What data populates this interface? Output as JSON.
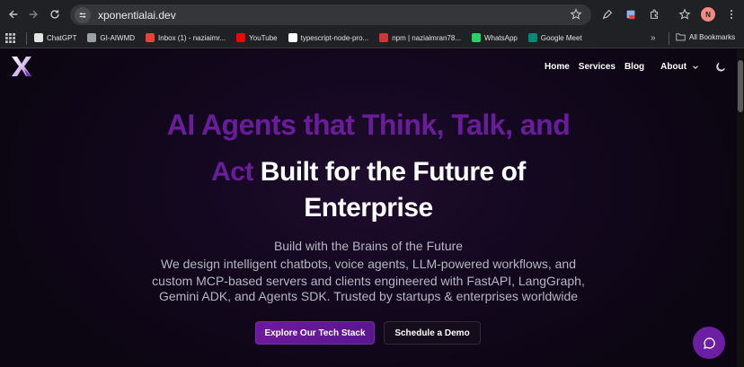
{
  "browser": {
    "url": "xponentialai.dev",
    "profile_initial": "N",
    "bookmarks": [
      {
        "label": "ChatGPT",
        "icon": "chatgpt-icon",
        "color": "#e3e3e3"
      },
      {
        "label": "GI-AIWMD",
        "icon": "github-style-icon",
        "color": "#9aa0a6"
      },
      {
        "label": "Inbox (1) - naziaimr...",
        "icon": "gmail-icon",
        "color": "#ea4335"
      },
      {
        "label": "YouTube",
        "icon": "youtube-icon",
        "color": "#ff0000"
      },
      {
        "label": "typescript-node-pro...",
        "icon": "github-icon",
        "color": "#ffffff"
      },
      {
        "label": "npm | naziaimran78...",
        "icon": "npm-icon",
        "color": "#cb3837"
      },
      {
        "label": "WhatsApp",
        "icon": "whatsapp-icon",
        "color": "#25d366"
      },
      {
        "label": "Google Meet",
        "icon": "google-meet-icon",
        "color": "#00897b"
      }
    ],
    "more_label": "»",
    "all_bookmarks_label": "All Bookmarks"
  },
  "site": {
    "nav": {
      "home": "Home",
      "services": "Services",
      "blog": "Blog",
      "about": "About"
    },
    "hero": {
      "line1": "AI Agents that Think, Talk, and",
      "line2_purple": "Act",
      "line2_white": " Built for the Future of",
      "line3": "Enterprise",
      "tagline": "Build with the Brains of the Future",
      "desc1": "We design intelligent chatbots, voice agents, LLM-powered workflows, and",
      "desc2": "custom MCP-based servers and clients engineered with FastAPI, LangGraph,",
      "desc3": "Gemini ADK, and Agents SDK. Trusted by startups & enterprises worldwide"
    },
    "buttons": {
      "primary": "Explore Our Tech Stack",
      "secondary": "Schedule a Demo"
    },
    "colors": {
      "accent": "#6a1d9a",
      "background": "#0d0612"
    }
  }
}
